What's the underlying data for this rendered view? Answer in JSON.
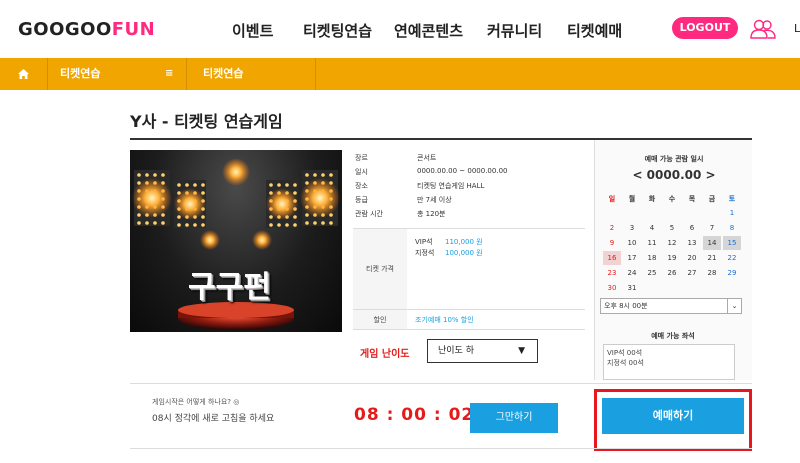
{
  "header": {
    "logo_part1": "GOOGOO",
    "logo_part2": "FUN",
    "nav": [
      "이벤트",
      "티켓팅연습",
      "연예콘텐츠",
      "커뮤니티",
      "티켓예매"
    ],
    "logout_label": "LOGOUT",
    "clipped_text": "L"
  },
  "breadcrumb": {
    "item1": "티켓연습",
    "separator": "≡",
    "item2": "티켓연습"
  },
  "page_title": "Y사 - 티켓팅 연습게임",
  "poster": {
    "text": "구구펀"
  },
  "info": {
    "rows": [
      {
        "label": "장르",
        "value": "콘서트"
      },
      {
        "label": "일시",
        "value": "0000.00.00 ~ 0000.00.00"
      },
      {
        "label": "장소",
        "value": "티켓팅 연습게임 HALL"
      },
      {
        "label": "등급",
        "value": "만 7세 이상"
      },
      {
        "label": "관람 시간",
        "value": "총 120분"
      }
    ],
    "price_label": "티켓 가격",
    "prices": [
      {
        "seat": "VIP석",
        "price": "110,000 원"
      },
      {
        "seat": "지정석",
        "price": "100,000 원"
      }
    ],
    "discount_label": "할인",
    "discount_value": "조기예매 10% 할인"
  },
  "difficulty": {
    "label": "게임 난이도",
    "selected": "난이도 하",
    "arrow": "▼"
  },
  "calendar": {
    "title": "예매 가능 관람 일시",
    "month": "< 0000.00 >",
    "weekdays": [
      "일",
      "월",
      "화",
      "수",
      "목",
      "금",
      "토"
    ],
    "weeks": [
      [
        "",
        "",
        "",
        "",
        "",
        "",
        "1"
      ],
      [
        "2",
        "3",
        "4",
        "5",
        "6",
        "7",
        "8"
      ],
      [
        "9",
        "10",
        "11",
        "12",
        "13",
        "14",
        "15"
      ],
      [
        "16",
        "17",
        "18",
        "19",
        "20",
        "21",
        "22"
      ],
      [
        "23",
        "24",
        "25",
        "26",
        "27",
        "28",
        "29"
      ],
      [
        "30",
        "31",
        "",
        "",
        "",
        "",
        ""
      ]
    ],
    "highlighted_gray": [
      "14",
      "15"
    ],
    "highlighted_pink": [
      "16"
    ],
    "time_selected": "오후 8시 00분",
    "time_arrow": "⌄",
    "colors": {
      "sunday": "#e51b1b",
      "saturday": "#1a6fd0",
      "gray_bg": "#d5d5d5",
      "pink_bg": "#f1d3d3"
    }
  },
  "seats": {
    "title": "예매 가능 좌석",
    "lines": [
      "VIP석 00석",
      "지정석 00석"
    ]
  },
  "bottom": {
    "hint_question": "게임시작은 어떻게 하나요? ◎",
    "hint_text": "08시 정각에 새로 고침을 하세요",
    "timer": "08 : 00 : 02",
    "stop_label": "그만하기",
    "book_label": "예매하기"
  },
  "colors": {
    "accent_pink": "#ff2a7f",
    "breadcrumb_orange": "#f0a500",
    "button_blue": "#1aa0e0",
    "alert_red": "#e51b1b"
  }
}
